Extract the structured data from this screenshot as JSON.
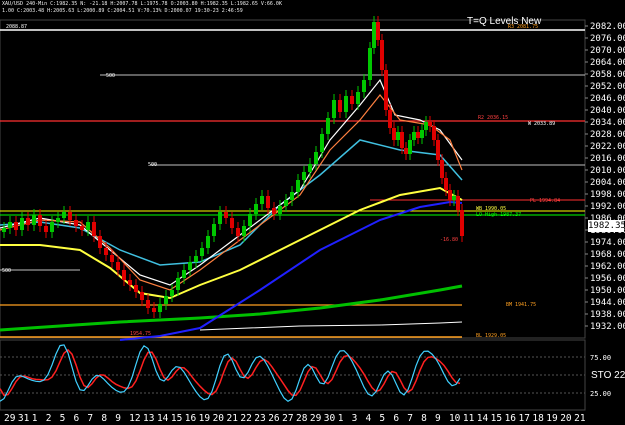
{
  "header": {
    "line1": "XAU/USD 240-Min C:1982.35 N: -21.18 H:2007.78 L:1975.78 O:2003.80 H:1982.35 L:1982.65 V:66.0K",
    "line2": "1.00 C:2003.48 H:2005.63 L:2000.89 C:2004.51 V:70.13% D:2000.07 19:30-23 2:46:59"
  },
  "title": "T=Q Levels New",
  "current_price": "1982.35",
  "stoch_label": "STO 22",
  "price_axis": [
    "2082.00",
    "2076.00",
    "2070.00",
    "2064.00",
    "2058.00",
    "2052.00",
    "2046.00",
    "2040.00",
    "2034.00",
    "2028.00",
    "2022.00",
    "2016.00",
    "2010.00",
    "2004.00",
    "1998.00",
    "1992.00",
    "1986.00",
    "1980.00",
    "1974.00",
    "1968.00",
    "1962.00",
    "1956.00",
    "1950.00",
    "1944.00",
    "1938.00",
    "1932.00"
  ],
  "osc_axis": [
    "75.00",
    "50.00",
    "25.00"
  ],
  "dates": [
    "29",
    "31",
    "1",
    "2",
    "5",
    "6",
    "7",
    "8",
    "9",
    "12",
    "13",
    "14",
    "15",
    "16",
    "19",
    "20",
    "21",
    "22",
    "23",
    "26",
    "27",
    "28",
    "29",
    "30",
    "1",
    "3",
    "4",
    "5",
    "6",
    "7",
    "8",
    "9",
    "10",
    "11",
    "14",
    "15",
    "16",
    "17",
    "18",
    "19",
    "20",
    "21"
  ],
  "level_labels": {
    "top": "2088.87",
    "r1": "R3  2081.75",
    "r2": "R2  2036.15",
    "r3": "W  2033.89",
    "pivot": "PL  1994.84",
    "wb": "WB  1990.05",
    "lo": "LO High  1987.37",
    "change": "-16.80",
    "s1": "BM  1941.75",
    "s2": "BL  1929.05",
    "left500a": "500",
    "left500b": "500",
    "left500c": "500",
    "mid1": "1954.75"
  },
  "colors": {
    "bull": "#00c800",
    "bear": "#e00000",
    "ema_yellow": "#ffff40",
    "ema_blue": "#2020ff",
    "ema_green": "#00c000",
    "ema_cyan": "#40c0e0",
    "ema_white": "#ffffff",
    "ema_orange": "#ff8040"
  }
}
